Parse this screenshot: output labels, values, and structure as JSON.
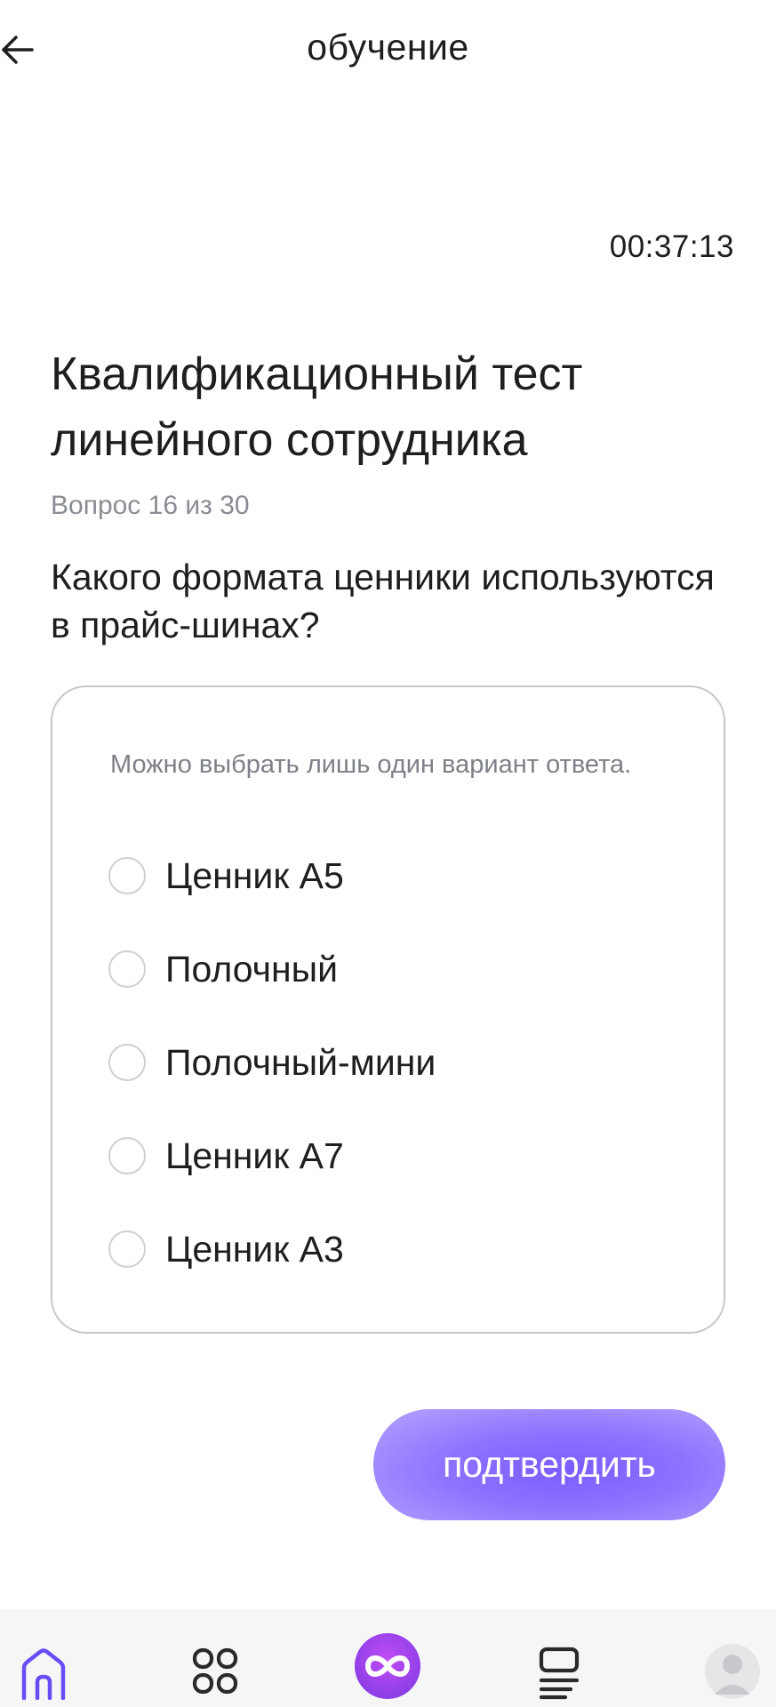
{
  "header": {
    "title": "обучение"
  },
  "timer": "00:37:13",
  "test": {
    "title": "Квалификационный тест линейного сотрудника",
    "counter": "Вопрос 16 из 30",
    "question": "Какого формата ценники используются в прайс-шинах?"
  },
  "answers": {
    "hint": "Можно выбрать лишь один вариант ответа.",
    "options": [
      "Ценник А5",
      "Полочный",
      "Полочный-мини",
      "Ценник А7",
      "Ценник А3"
    ]
  },
  "confirm_label": "подтвердить",
  "nav": {
    "items": [
      "home-icon",
      "apps-grid-icon",
      "infinity-icon",
      "courses-icon",
      "profile-avatar"
    ]
  },
  "colors": {
    "accent": "#7c5cff",
    "nav_active": "#6a4cf5",
    "text_primary": "#1e1e1e",
    "text_secondary": "#8a8c93",
    "card_border": "#c5c6cb"
  }
}
